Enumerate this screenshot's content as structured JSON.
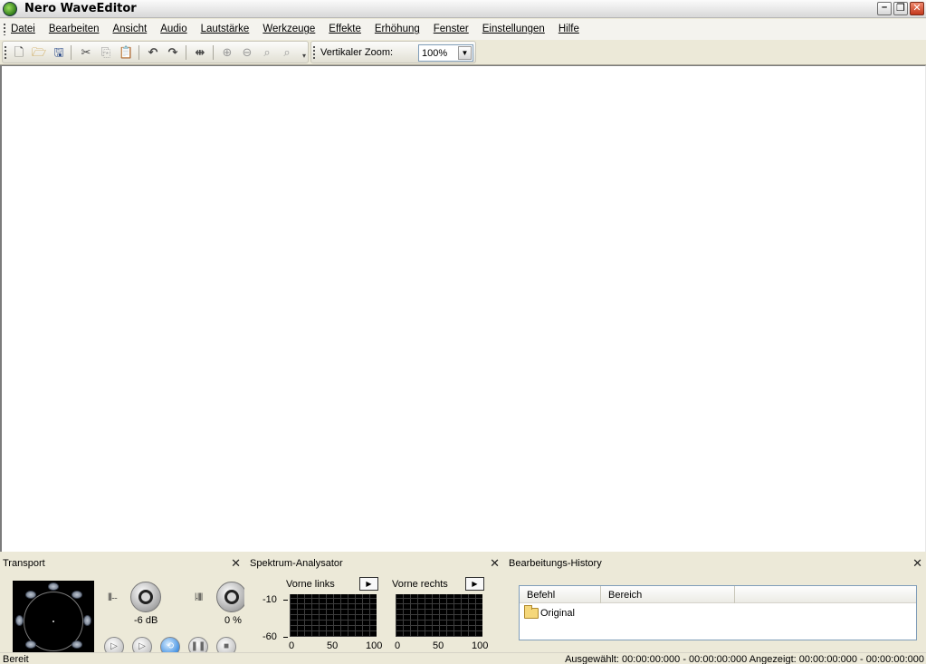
{
  "window": {
    "title": "Nero WaveEditor"
  },
  "menu": [
    "Datei",
    "Bearbeiten",
    "Ansicht",
    "Audio",
    "Lautstärke",
    "Werkzeuge",
    "Effekte",
    "Erhöhung",
    "Fenster",
    "Einstellungen",
    "Hilfe"
  ],
  "toolbar": {
    "zoom_label": "Vertikaler Zoom:",
    "zoom_value": "100%"
  },
  "transport": {
    "title": "Transport",
    "volume_label": "-6 dB",
    "speed_label": "0 %"
  },
  "spectrum": {
    "title": "Spektrum-Analysator",
    "left_label": "Vorne links",
    "right_label": "Vorne rechts",
    "y_top": "-10",
    "y_bottom": "-60",
    "x_ticks": [
      "0",
      "50",
      "100"
    ]
  },
  "history": {
    "title": "Bearbeitungs-History",
    "col_command": "Befehl",
    "col_range": "Bereich",
    "rows": [
      "Original"
    ]
  },
  "status": {
    "left": "Bereit",
    "right": "Ausgewählt: 00:00:00:000 - 00:00:00:000  Angezeigt: 00:00:00:000 - 00:00:00:000"
  }
}
